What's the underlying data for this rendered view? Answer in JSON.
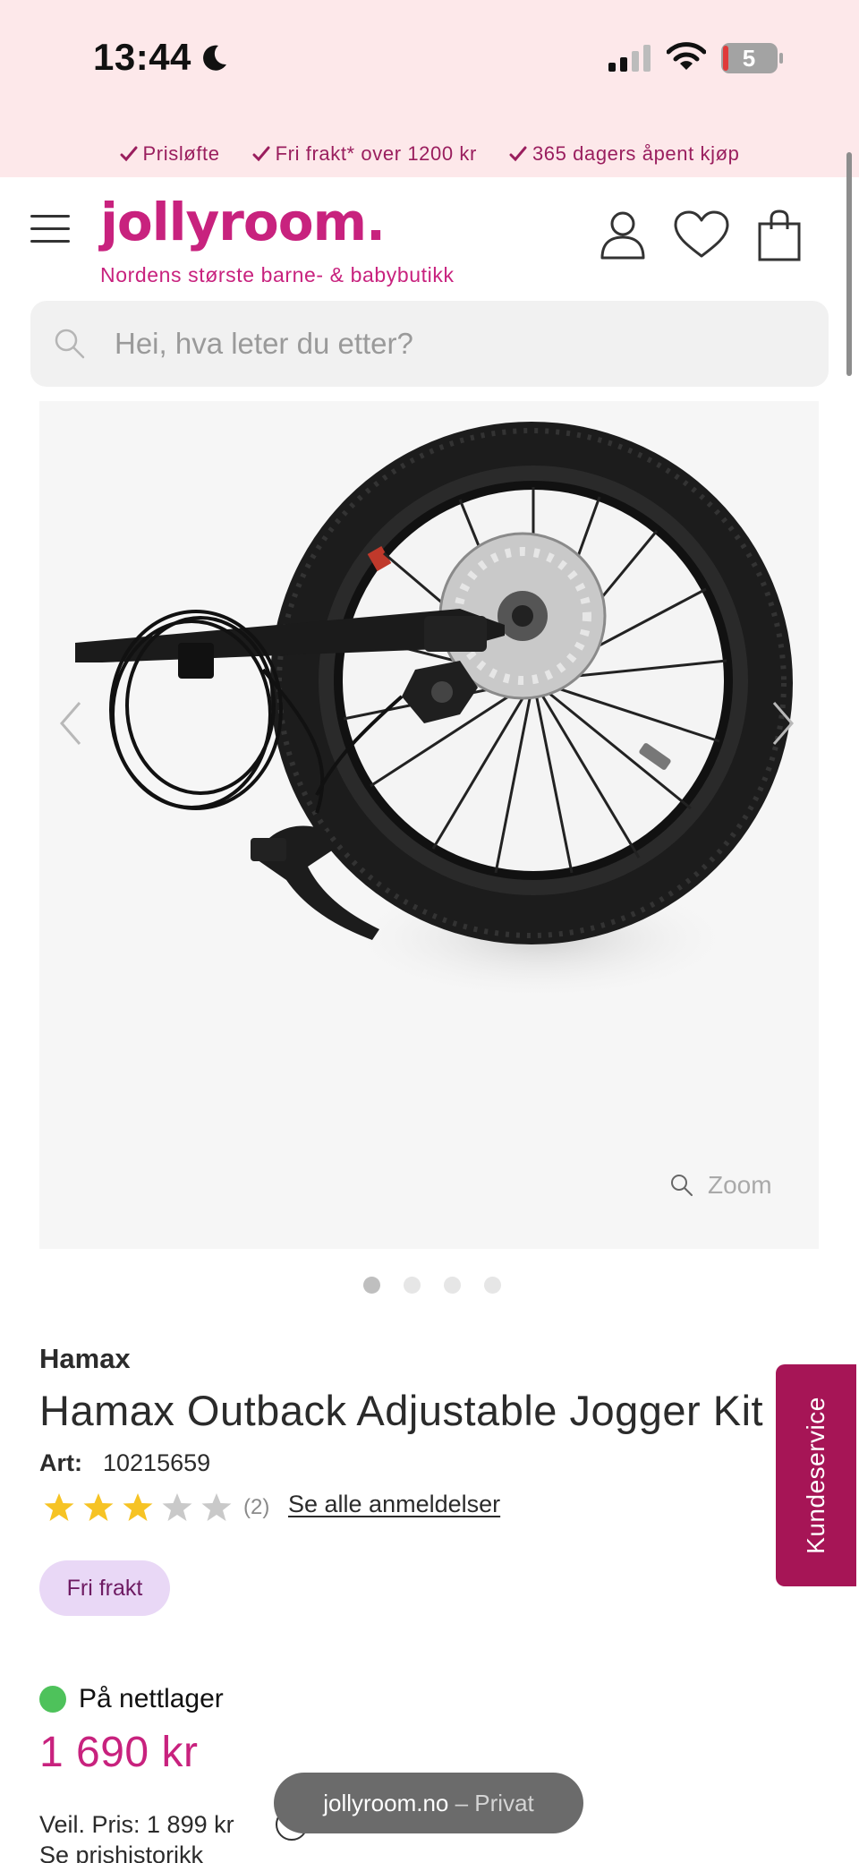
{
  "status_bar": {
    "time": "13:44",
    "battery": "5",
    "icons": [
      "moon-icon",
      "signal-icon",
      "wifi-icon",
      "battery-icon"
    ]
  },
  "usp": [
    {
      "label": "Prisløfte"
    },
    {
      "label": "Fri frakt* over 1200 kr"
    },
    {
      "label": "365 dagers åpent kjøp"
    }
  ],
  "header": {
    "logo": "jollyroom.",
    "tagline": "Nordens største barne- & babybutikk",
    "icons": [
      "menu-icon",
      "account-icon",
      "heart-icon",
      "bag-icon"
    ]
  },
  "search": {
    "placeholder": "Hei, hva leter du etter?"
  },
  "gallery": {
    "zoom_label": "Zoom",
    "image_count": 4,
    "active_index": 0
  },
  "product": {
    "brand": "Hamax",
    "title": "Hamax Outback Adjustable Jogger Kit",
    "art_label": "Art:",
    "art_number": "10215659",
    "rating": 3,
    "rating_max": 5,
    "review_count": "(2)",
    "reviews_link": "Se alle anmeldelser",
    "badge": "Fri frakt",
    "stock_status": "På nettlager",
    "price": "1 690 kr",
    "rrp": "Veil. Pris: 1 899 kr",
    "price_history_link": "Se prishistorikk"
  },
  "side_tab": {
    "label": "Kundeservice"
  },
  "browser": {
    "domain": "jollyroom.no",
    "mode": " – Privat"
  },
  "colors": {
    "brand": "#c8227e",
    "top_bar": "#fde8ea",
    "usp_text": "#9a1e5e",
    "side_tab": "#a61556",
    "badge_bg": "#e9d8f6",
    "stock": "#4ec25b",
    "star": "#f6c324"
  }
}
